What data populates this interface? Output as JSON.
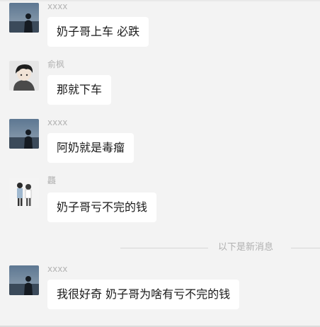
{
  "messages": [
    {
      "sender": "xxxx",
      "text": "奶子哥上车 必跌",
      "avatar": "night-sky-avatar"
    },
    {
      "sender": "俞枫",
      "text": "那就下车",
      "avatar": "anime-boy-avatar"
    },
    {
      "sender": "xxxx",
      "text": "阿奶就是毒瘤",
      "avatar": "night-sky-avatar"
    },
    {
      "sender": "龘",
      "text": "奶子哥亏不完的钱",
      "avatar": "couple-illustration-avatar"
    },
    {
      "sender": "xxxx",
      "text": "我很好奇 奶子哥为啥有亏不完的钱",
      "avatar": "night-sky-avatar"
    }
  ],
  "divider": {
    "label": "以下是新消息"
  },
  "colors": {
    "background": "#f3f3f3",
    "bubble": "#ffffff",
    "sender": "#b3b3b3",
    "text": "#1a1a1a"
  }
}
